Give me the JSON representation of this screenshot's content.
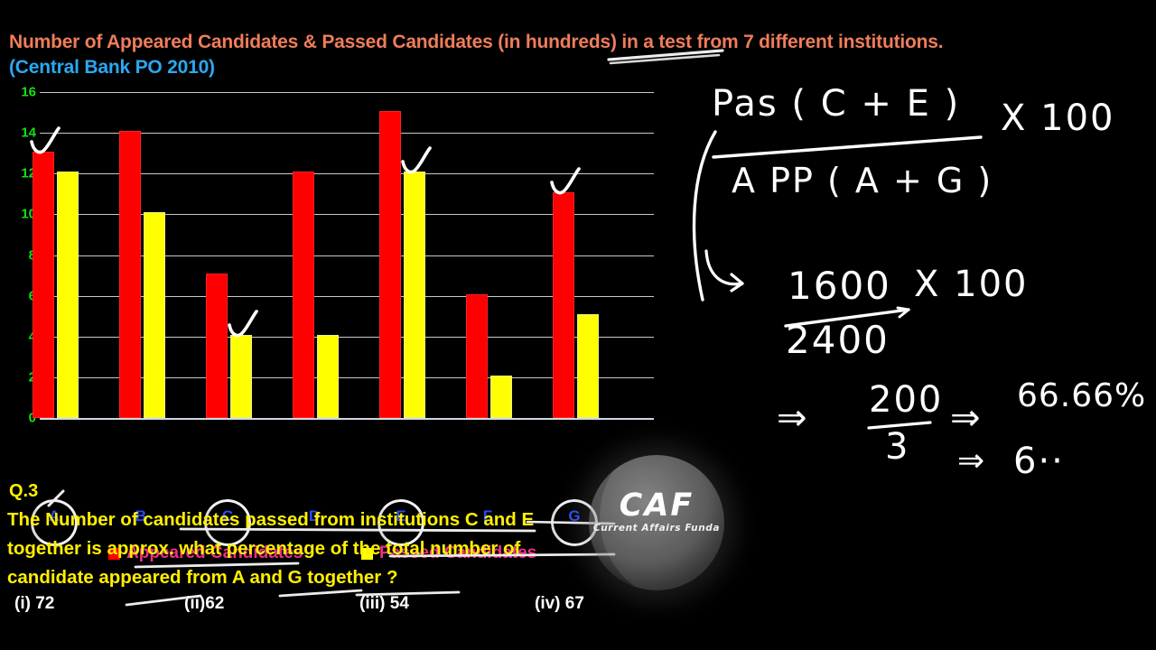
{
  "title": {
    "line1": "Number of Appeared Candidates & Passed Candidates (in hundreds) in a test from 7 different institutions.",
    "line2": "(Central Bank PO 2010)",
    "color1": "#ef7d5a",
    "color2": "#29a9f2"
  },
  "chart_data": {
    "type": "bar",
    "title": "Number of Appeared Candidates & Passed Candidates (in hundreds) in a test from 7 different institutions.",
    "subtitle": "(Central Bank PO 2010)",
    "xlabel": "",
    "ylabel": "",
    "categories": [
      "A",
      "B",
      "C",
      "D",
      "E",
      "F",
      "G"
    ],
    "series": [
      {
        "name": "Appeared Candidates",
        "color": "#ff0000",
        "values": [
          13,
          14,
          7,
          12,
          15,
          6,
          11
        ]
      },
      {
        "name": "Passed Candidates",
        "color": "#ffff00",
        "values": [
          12,
          10,
          4,
          4,
          12,
          2,
          5
        ]
      }
    ],
    "ylim": [
      0,
      16
    ],
    "yticks": [
      0,
      2,
      4,
      6,
      8,
      10,
      12,
      14,
      16
    ],
    "ytick_color": "#14e014",
    "grid": true,
    "legend_position": "bottom",
    "annotations": {
      "circled_categories": [
        "A",
        "C",
        "E",
        "G"
      ],
      "checkmarked_bars": [
        "A-appeared",
        "C-passed",
        "E-passed",
        "G-appeared"
      ]
    }
  },
  "axis": {
    "ytick_labels": [
      "16",
      "14",
      "12",
      "10",
      "8",
      "6",
      "4",
      "2",
      "0"
    ],
    "xtick_labels": [
      "A",
      "B",
      "C",
      "D",
      "E",
      "F",
      "G"
    ]
  },
  "legend": {
    "items": [
      {
        "label": "Appeared Candidates",
        "swatch": "#ff0000"
      },
      {
        "label": "Passed Candidates",
        "swatch": "#ffff00"
      }
    ],
    "text_color": "#ee2f86"
  },
  "question": {
    "number": "Q.3",
    "lines": [
      "The Number of candidates passed from institutions C and E",
      "together is approx. what percentage  of  the total number of",
      "candidate appeared from  A and G together ?"
    ],
    "options": [
      {
        "key": "(i)",
        "value": "72",
        "text": "(i) 72"
      },
      {
        "key": "(ii)",
        "value": "62",
        "text": "(ii)62"
      },
      {
        "key": "(iii)",
        "value": "54",
        "text": "(iii) 54"
      },
      {
        "key": "(iv)",
        "value": "67",
        "text": "(iv) 67"
      }
    ],
    "text_color": "#ffef00",
    "option_color": "#ffffff"
  },
  "handwriting": {
    "formula_numerator": "Pas ( C + E )",
    "formula_denominator": "A PP ( A + G )",
    "formula_multiplier": "X 100",
    "fraction_numerator": "1600",
    "fraction_denominator": "2400",
    "fraction_multiplier": "X 100",
    "step_arrow_1": "⇒",
    "step_value_numerator": "200",
    "step_value_denominator": "3",
    "step_arrow_2": "⇒",
    "result": "66.66%",
    "step_arrow_3": "⇒",
    "result_partial": "6··"
  },
  "watermark": {
    "brand": "CAF",
    "tagline": "Current Affairs Funda"
  }
}
